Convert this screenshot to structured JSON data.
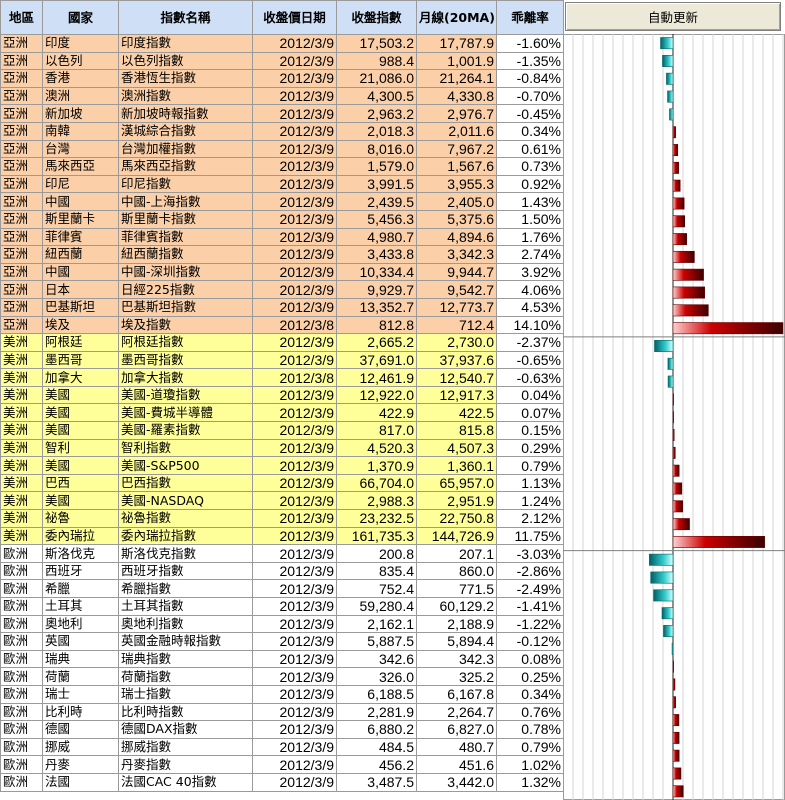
{
  "header": {
    "region": "地區",
    "country": "國家",
    "index_name": "指數名稱",
    "close_date": "收盤價日期",
    "close_index": "收盤指數",
    "ma20": "月線(20MA)",
    "deviation": "乖離率"
  },
  "refresh_button": "自動更新",
  "colors": {
    "header_bg": "#cfe0f6",
    "asia_bg": "#fbcfa8",
    "americas_bg": "#ffff99",
    "europe_bg": "#ffffff",
    "negative_bar": "#33cccc",
    "positive_bar": "#cc0000"
  },
  "rows": [
    {
      "group": "asia",
      "region": "亞洲",
      "country": "印度",
      "name": "印度指數",
      "date": "2012/3/9",
      "close": "17,503.2",
      "ma": "17,787.9",
      "rate": "-1.60%",
      "v": -1.6
    },
    {
      "group": "asia",
      "region": "亞洲",
      "country": "以色列",
      "name": "以色列指數",
      "date": "2012/3/9",
      "close": "988.4",
      "ma": "1,001.9",
      "rate": "-1.35%",
      "v": -1.35
    },
    {
      "group": "asia",
      "region": "亞洲",
      "country": "香港",
      "name": "香港恆生指數",
      "date": "2012/3/9",
      "close": "21,086.0",
      "ma": "21,264.1",
      "rate": "-0.84%",
      "v": -0.84
    },
    {
      "group": "asia",
      "region": "亞洲",
      "country": "澳洲",
      "name": "澳洲指數",
      "date": "2012/3/9",
      "close": "4,300.5",
      "ma": "4,330.8",
      "rate": "-0.70%",
      "v": -0.7
    },
    {
      "group": "asia",
      "region": "亞洲",
      "country": "新加坡",
      "name": "新加坡時報指數",
      "date": "2012/3/9",
      "close": "2,963.2",
      "ma": "2,976.7",
      "rate": "-0.45%",
      "v": -0.45
    },
    {
      "group": "asia",
      "region": "亞洲",
      "country": "南韓",
      "name": "漢城綜合指數",
      "date": "2012/3/9",
      "close": "2,018.3",
      "ma": "2,011.6",
      "rate": "0.34%",
      "v": 0.34
    },
    {
      "group": "asia",
      "region": "亞洲",
      "country": "台灣",
      "name": "台灣加權指數",
      "date": "2012/3/9",
      "close": "8,016.0",
      "ma": "7,967.2",
      "rate": "0.61%",
      "v": 0.61
    },
    {
      "group": "asia",
      "region": "亞洲",
      "country": "馬來西亞",
      "name": "馬來西亞指數",
      "date": "2012/3/9",
      "close": "1,579.0",
      "ma": "1,567.6",
      "rate": "0.73%",
      "v": 0.73
    },
    {
      "group": "asia",
      "region": "亞洲",
      "country": "印尼",
      "name": "印尼指數",
      "date": "2012/3/9",
      "close": "3,991.5",
      "ma": "3,955.3",
      "rate": "0.92%",
      "v": 0.92
    },
    {
      "group": "asia",
      "region": "亞洲",
      "country": "中國",
      "name": "中國-上海指數",
      "date": "2012/3/9",
      "close": "2,439.5",
      "ma": "2,405.0",
      "rate": "1.43%",
      "v": 1.43
    },
    {
      "group": "asia",
      "region": "亞洲",
      "country": "斯里蘭卡",
      "name": "斯里蘭卡指數",
      "date": "2012/3/9",
      "close": "5,456.3",
      "ma": "5,375.6",
      "rate": "1.50%",
      "v": 1.5
    },
    {
      "group": "asia",
      "region": "亞洲",
      "country": "菲律賓",
      "name": "菲律賓指數",
      "date": "2012/3/9",
      "close": "4,980.7",
      "ma": "4,894.6",
      "rate": "1.76%",
      "v": 1.76
    },
    {
      "group": "asia",
      "region": "亞洲",
      "country": "紐西蘭",
      "name": "紐西蘭指數",
      "date": "2012/3/9",
      "close": "3,433.8",
      "ma": "3,342.3",
      "rate": "2.74%",
      "v": 2.74
    },
    {
      "group": "asia",
      "region": "亞洲",
      "country": "中國",
      "name": "中國-深圳指數",
      "date": "2012/3/9",
      "close": "10,334.4",
      "ma": "9,944.7",
      "rate": "3.92%",
      "v": 3.92
    },
    {
      "group": "asia",
      "region": "亞洲",
      "country": "日本",
      "name": "日經225指數",
      "date": "2012/3/9",
      "close": "9,929.7",
      "ma": "9,542.7",
      "rate": "4.06%",
      "v": 4.06
    },
    {
      "group": "asia",
      "region": "亞洲",
      "country": "巴基斯坦",
      "name": "巴基斯坦指數",
      "date": "2012/3/9",
      "close": "13,352.7",
      "ma": "12,773.7",
      "rate": "4.53%",
      "v": 4.53
    },
    {
      "group": "asia",
      "region": "亞洲",
      "country": "埃及",
      "name": "埃及指數",
      "date": "2012/3/8",
      "close": "812.8",
      "ma": "712.4",
      "rate": "14.10%",
      "v": 14.1
    },
    {
      "group": "americas",
      "region": "美洲",
      "country": "阿根廷",
      "name": "阿根廷指數",
      "date": "2012/3/9",
      "close": "2,665.2",
      "ma": "2,730.0",
      "rate": "-2.37%",
      "v": -2.37
    },
    {
      "group": "americas",
      "region": "美洲",
      "country": "墨西哥",
      "name": "墨西哥指數",
      "date": "2012/3/9",
      "close": "37,691.0",
      "ma": "37,937.6",
      "rate": "-0.65%",
      "v": -0.65
    },
    {
      "group": "americas",
      "region": "美洲",
      "country": "加拿大",
      "name": "加拿大指數",
      "date": "2012/3/8",
      "close": "12,461.9",
      "ma": "12,540.7",
      "rate": "-0.63%",
      "v": -0.63
    },
    {
      "group": "americas",
      "region": "美洲",
      "country": "美國",
      "name": "美國-道瓊指數",
      "date": "2012/3/9",
      "close": "12,922.0",
      "ma": "12,917.3",
      "rate": "0.04%",
      "v": 0.04
    },
    {
      "group": "americas",
      "region": "美洲",
      "country": "美國",
      "name": "美國-費城半導體",
      "date": "2012/3/9",
      "close": "422.9",
      "ma": "422.5",
      "rate": "0.07%",
      "v": 0.07
    },
    {
      "group": "americas",
      "region": "美洲",
      "country": "美國",
      "name": "美國-羅素指數",
      "date": "2012/3/9",
      "close": "817.0",
      "ma": "815.8",
      "rate": "0.15%",
      "v": 0.15
    },
    {
      "group": "americas",
      "region": "美洲",
      "country": "智利",
      "name": "智利指數",
      "date": "2012/3/9",
      "close": "4,520.3",
      "ma": "4,507.3",
      "rate": "0.29%",
      "v": 0.29
    },
    {
      "group": "americas",
      "region": "美洲",
      "country": "美國",
      "name": "美國-S&P500",
      "date": "2012/3/9",
      "close": "1,370.9",
      "ma": "1,360.1",
      "rate": "0.79%",
      "v": 0.79
    },
    {
      "group": "americas",
      "region": "美洲",
      "country": "巴西",
      "name": "巴西指數",
      "date": "2012/3/9",
      "close": "66,704.0",
      "ma": "65,957.0",
      "rate": "1.13%",
      "v": 1.13
    },
    {
      "group": "americas",
      "region": "美洲",
      "country": "美國",
      "name": "美國-NASDAQ",
      "date": "2012/3/9",
      "close": "2,988.3",
      "ma": "2,951.9",
      "rate": "1.24%",
      "v": 1.24
    },
    {
      "group": "americas",
      "region": "美洲",
      "country": "祕魯",
      "name": "祕魯指數",
      "date": "2012/3/9",
      "close": "23,232.5",
      "ma": "22,750.8",
      "rate": "2.12%",
      "v": 2.12
    },
    {
      "group": "americas",
      "region": "美洲",
      "country": "委內瑞拉",
      "name": "委內瑞拉指數",
      "date": "2012/3/9",
      "close": "161,735.3",
      "ma": "144,726.9",
      "rate": "11.75%",
      "v": 11.75
    },
    {
      "group": "europe",
      "region": "歐洲",
      "country": "斯洛伐克",
      "name": "斯洛伐克指數",
      "date": "2012/3/9",
      "close": "200.8",
      "ma": "207.1",
      "rate": "-3.03%",
      "v": -3.03
    },
    {
      "group": "europe",
      "region": "歐洲",
      "country": "西班牙",
      "name": "西班牙指數",
      "date": "2012/3/9",
      "close": "835.4",
      "ma": "860.0",
      "rate": "-2.86%",
      "v": -2.86
    },
    {
      "group": "europe",
      "region": "歐洲",
      "country": "希臘",
      "name": "希臘指數",
      "date": "2012/3/9",
      "close": "752.4",
      "ma": "771.5",
      "rate": "-2.49%",
      "v": -2.49
    },
    {
      "group": "europe",
      "region": "歐洲",
      "country": "土耳其",
      "name": "土耳其指數",
      "date": "2012/3/9",
      "close": "59,280.4",
      "ma": "60,129.2",
      "rate": "-1.41%",
      "v": -1.41
    },
    {
      "group": "europe",
      "region": "歐洲",
      "country": "奧地利",
      "name": "奧地利指數",
      "date": "2012/3/9",
      "close": "2,162.1",
      "ma": "2,188.9",
      "rate": "-1.22%",
      "v": -1.22
    },
    {
      "group": "europe",
      "region": "歐洲",
      "country": "英國",
      "name": "英國金融時報指數",
      "date": "2012/3/9",
      "close": "5,887.5",
      "ma": "5,894.4",
      "rate": "-0.12%",
      "v": -0.12
    },
    {
      "group": "europe",
      "region": "歐洲",
      "country": "瑞典",
      "name": "瑞典指數",
      "date": "2012/3/9",
      "close": "342.6",
      "ma": "342.3",
      "rate": "0.08%",
      "v": 0.08
    },
    {
      "group": "europe",
      "region": "歐洲",
      "country": "荷蘭",
      "name": "荷蘭指數",
      "date": "2012/3/9",
      "close": "326.0",
      "ma": "325.2",
      "rate": "0.25%",
      "v": 0.25
    },
    {
      "group": "europe",
      "region": "歐洲",
      "country": "瑞士",
      "name": "瑞士指數",
      "date": "2012/3/9",
      "close": "6,188.5",
      "ma": "6,167.8",
      "rate": "0.34%",
      "v": 0.34
    },
    {
      "group": "europe",
      "region": "歐洲",
      "country": "比利時",
      "name": "比利時指數",
      "date": "2012/3/9",
      "close": "2,281.9",
      "ma": "2,264.7",
      "rate": "0.76%",
      "v": 0.76
    },
    {
      "group": "europe",
      "region": "歐洲",
      "country": "德國",
      "name": "德國DAX指數",
      "date": "2012/3/9",
      "close": "6,880.2",
      "ma": "6,827.0",
      "rate": "0.78%",
      "v": 0.78
    },
    {
      "group": "europe",
      "region": "歐洲",
      "country": "挪威",
      "name": "挪威指數",
      "date": "2012/3/9",
      "close": "484.5",
      "ma": "480.7",
      "rate": "0.79%",
      "v": 0.79
    },
    {
      "group": "europe",
      "region": "歐洲",
      "country": "丹麥",
      "name": "丹麥指數",
      "date": "2012/3/9",
      "close": "456.2",
      "ma": "451.6",
      "rate": "1.02%",
      "v": 1.02
    },
    {
      "group": "europe",
      "region": "歐洲",
      "country": "法國",
      "name": "法國CAC 40指數",
      "date": "2012/3/9",
      "close": "3,487.5",
      "ma": "3,442.0",
      "rate": "1.32%",
      "v": 1.32
    }
  ]
}
